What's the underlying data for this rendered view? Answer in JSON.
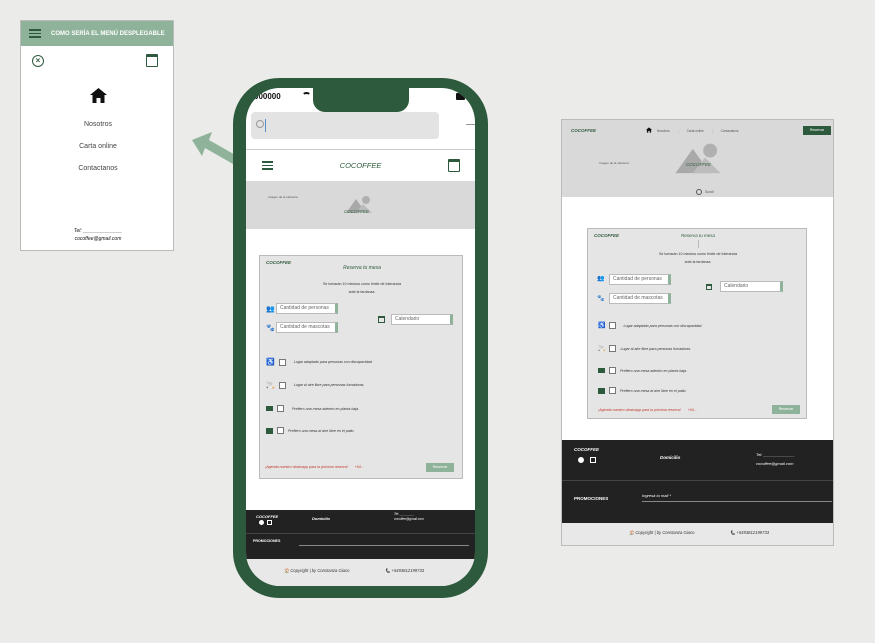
{
  "menu": {
    "header": "COMO SERÍA EL MENÚ DESPLEGABLE",
    "items": [
      "Nosotros",
      "Carta online",
      "Contactanos"
    ],
    "tel": "Tel: ______________",
    "email": "cocoffee@gmail.com"
  },
  "phone": {
    "carrier": "000000",
    "search_placeholder": "",
    "brand": "COCOFFEE",
    "banner_caption": "Imagen de la cafetería",
    "banner_logo": "COCOFFEE",
    "form": {
      "brand": "COCOFFEE",
      "title": "Reserva tu mesa",
      "note1": "Se tomarán 10 minutos como límite de tolerancia",
      "note2": "ante la tardanza.",
      "people_placeholder": "Cantidad de personas",
      "pets_placeholder": "Cantidad de mascotas",
      "calendar_placeholder": "Calendario",
      "options": [
        "Lugar adaptado para personas con discapacidad.",
        "Lugar al aire libre para personas fumadoras.",
        "Prefiero una mesa adentro en planta baja.",
        "Prefiero una mesa al aire libre en el patio."
      ],
      "whatsapp": "¡Agenda nuestro whatsapp para la próxima reserva!",
      "whatsapp_num": "+54...",
      "submit": "Reservar"
    },
    "footer": {
      "brand": "COCOFFEE",
      "domicilio": "Domicilio",
      "tel": "Tel: ________",
      "email": "cocoffee@gmail.com",
      "promociones": "PROMOCIONES",
      "copyright": "Copyright | by Constanza Giaco",
      "phone": "+5493812199733"
    }
  },
  "desktop": {
    "brand": "COCOFFEE",
    "nav": [
      "Nosotros",
      "Carta online",
      "Contactanos"
    ],
    "reservar": "Reservar",
    "banner_caption": "Imagen de la cafetería",
    "banner_logo": "COCOFFEE",
    "scroll": "Scroll",
    "form": {
      "brand": "COCOFFEE",
      "title": "Reserva tu mesa",
      "note1": "Se tomarán 10 minutos como límite de tolerancia",
      "note2": "ante la tardanza.",
      "people_placeholder": "Cantidad de personas",
      "pets_placeholder": "Cantidad de mascotas",
      "calendar_placeholder": "Calendario",
      "options": [
        "Lugar adaptado para personas con discapacidad.",
        "Lugar al aire libre para personas fumadoras.",
        "Prefiero una mesa adentro en planta baja.",
        "Prefiero una mesa al aire libre en el patio."
      ],
      "whatsapp": "¡Agenda nuestro whatsapp para la próxima reserva!",
      "whatsapp_num": "+54...",
      "submit": "Reservar"
    },
    "footer": {
      "brand": "COCOFFEE",
      "domicilio": "Domicilio",
      "tel": "Tel: ______________",
      "email": "cocoffee@gmail.com",
      "promociones": "PROMOCIONES",
      "mail_placeholder": "Ingresá tu mail *",
      "copyright": "Copyright | by Constanza Giaco",
      "phone": "+5493812199733"
    }
  },
  "colors": {
    "accent": "#2d5a3d",
    "menu_header": "#8fb39a",
    "background": "#ebebea",
    "footer": "#222222"
  }
}
